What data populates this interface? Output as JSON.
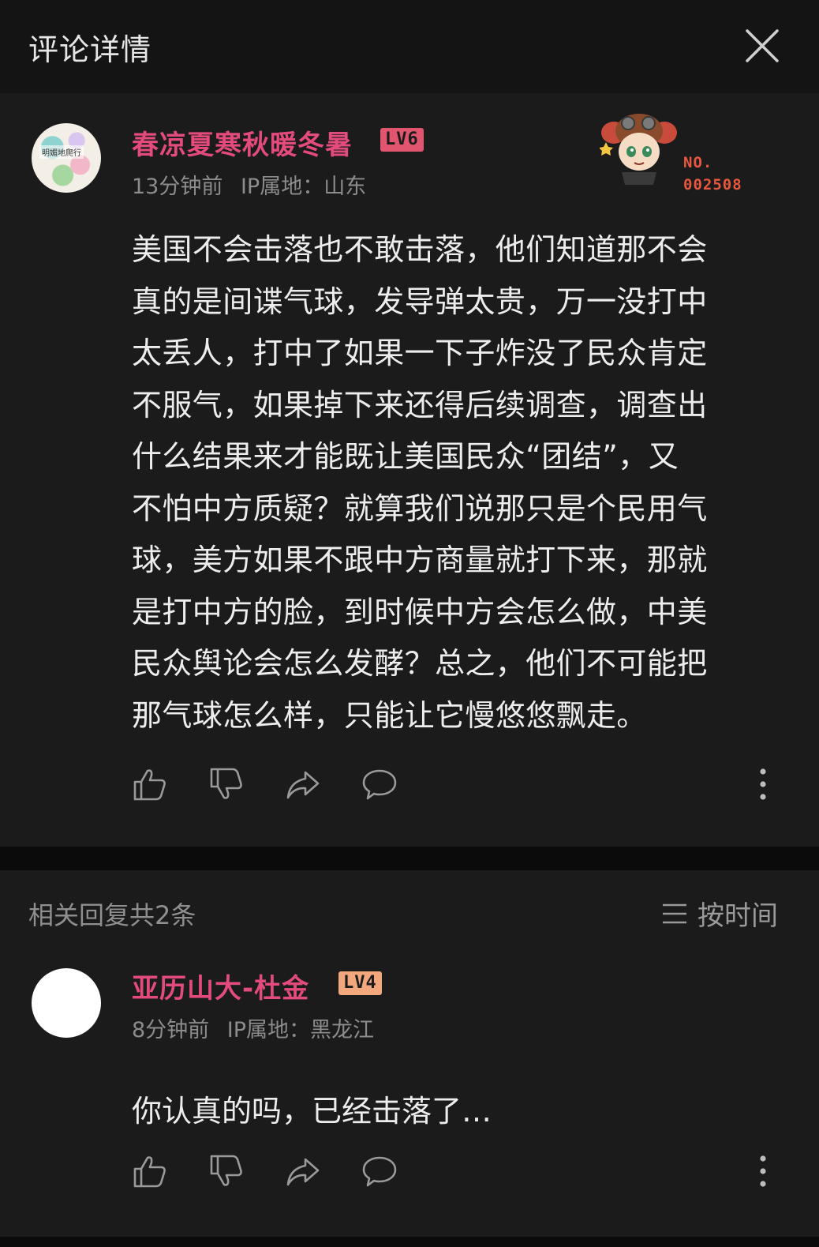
{
  "header": {
    "title": "评论详情"
  },
  "comment": {
    "username": "春凉夏寒秋暖冬暑",
    "level": "LV6",
    "time": "13分钟前",
    "ip": "IP属地：山东",
    "avatar_text": "明媚地爬行",
    "fan_badge": {
      "label": "NO.",
      "number": "002508"
    },
    "lines": [
      "美国不会击落也不敢击落，他们知道那不会",
      "真的是间谍气球，发导弹太贵，万一没打中",
      "太丢人，打中了如果一下子炸没了民众肯定",
      "不服气，如果掉下来还得后续调查，调查出",
      "什么结果来才能既让美国民众“团结”，又",
      "不怕中方质疑？就算我们说那只是个民用气",
      "球，美方如果不跟中方商量就打下来，那就",
      "是打中方的脸，到时候中方会怎么做，中美",
      "民众舆论会怎么发酵？总之，他们不可能把",
      "那气球怎么样，只能让它慢悠悠飘走。"
    ]
  },
  "replies_header": {
    "count_label": "相关回复共2条",
    "sort_label": "按时间"
  },
  "reply": {
    "username": "亚历山大-杜金",
    "level": "LV4",
    "time": "8分钟前",
    "ip": "IP属地：黑龙江",
    "text": "你认真的吗，已经击落了…"
  },
  "colors": {
    "username": "#e24b7c",
    "lv6": "#e2556f",
    "lv4": "#f2a77c",
    "fan_number": "#e8573e"
  }
}
